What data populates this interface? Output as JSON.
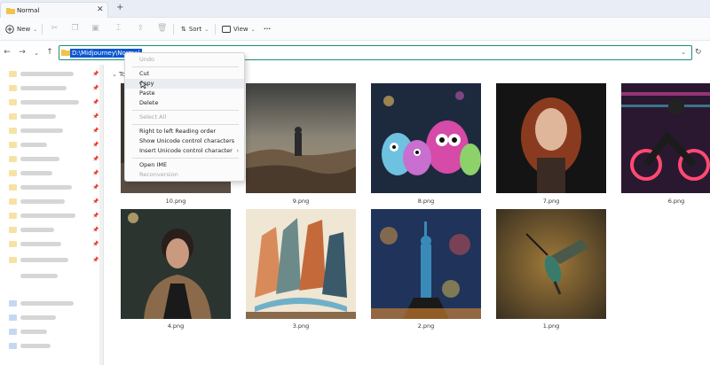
{
  "window": {
    "tab_title": "Normal",
    "close_glyph": "✕",
    "new_tab_glyph": "+"
  },
  "toolbar": {
    "new_label": "New",
    "sort_label": "Sort",
    "view_label": "View",
    "more_glyph": "···",
    "dropdown_glyph": "⌄"
  },
  "address": {
    "path": "D:\\Midjourney\\Normal"
  },
  "group": {
    "label": "To"
  },
  "files": [
    {
      "name": "10.png",
      "subject": "hooded-figure"
    },
    {
      "name": "9.png",
      "subject": "wanderer-desert-landscape"
    },
    {
      "name": "8.png",
      "subject": "cute-monsters"
    },
    {
      "name": "7.png",
      "subject": "red-haired-woman"
    },
    {
      "name": "6.png",
      "subject": "motorcycle-rider-neon"
    },
    {
      "name": "4.png",
      "subject": "woman-fur-coat"
    },
    {
      "name": "3.png",
      "subject": "abstract-canyon"
    },
    {
      "name": "2.png",
      "subject": "statue-of-liberty"
    },
    {
      "name": "1.png",
      "subject": "hummingbird"
    }
  ],
  "context_menu": {
    "undo": "Undo",
    "cut": "Cut",
    "copy": "Copy",
    "paste": "Paste",
    "delete": "Delete",
    "select_all": "Select All",
    "rtl": "Right to left Reading order",
    "show_unicode": "Show Unicode control characters",
    "insert_unicode": "Insert Unicode control character",
    "open_ime": "Open IME",
    "reconversion": "Reconversion"
  },
  "colors": {
    "accent": "#0b57d0",
    "address_border": "#1a8f7c",
    "folder": "#f1cf6a"
  }
}
